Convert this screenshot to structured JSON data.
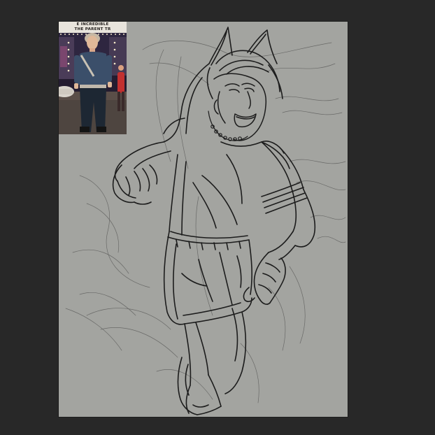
{
  "app": {
    "workspace_background": "#282828",
    "canvas_color": "#a3a4a0",
    "sketch_stroke_color": "#1c1c1c"
  },
  "reference_photo": {
    "marquee_line_1": "E INCREDIBLE",
    "marquee_line_2": "THE PARENT TR",
    "colors": {
      "night_sky": "#241c30",
      "marquee": "#e8e4dc",
      "jacket": "#3b4f6a",
      "jeans": "#1d2733",
      "pavement": "#4e4540",
      "red_figure": "#c23030",
      "lights": "#f4e9c8"
    }
  }
}
